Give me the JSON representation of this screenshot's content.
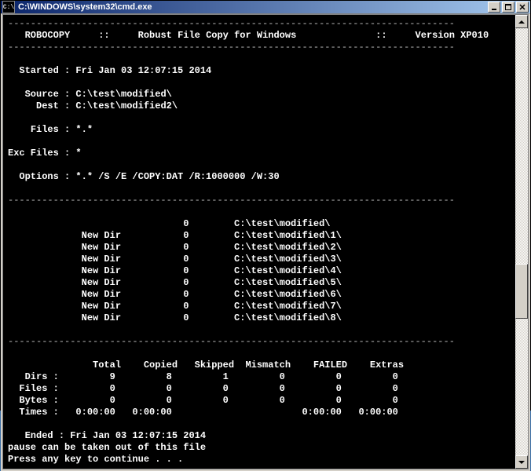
{
  "titlebar": {
    "icon_label": "C:\\",
    "title": "C:\\WINDOWS\\system32\\cmd.exe"
  },
  "hr": "-------------------------------------------------------------------------------",
  "header": {
    "name": "ROBOCOPY",
    "sep": "::",
    "desc": "Robust File Copy for Windows",
    "version": "Version XP010"
  },
  "info": {
    "started_label": "Started",
    "started_value": "Fri Jan 03 12:07:15 2014",
    "source_label": "Source",
    "source_value": "C:\\test\\modified\\",
    "dest_label": "Dest",
    "dest_value": "C:\\test\\modified2\\",
    "files_label": "Files",
    "files_value": "*.*",
    "excfiles_label": "Exc Files",
    "excfiles_value": "*",
    "options_label": "Options",
    "options_value": "*.* /S /E /COPY:DAT /R:1000000 /W:30"
  },
  "dirlist": {
    "newdir": "New Dir",
    "rows": [
      {
        "tag": "",
        "count": "0",
        "path": "C:\\test\\modified\\"
      },
      {
        "tag": "New Dir",
        "count": "0",
        "path": "C:\\test\\modified\\1\\"
      },
      {
        "tag": "New Dir",
        "count": "0",
        "path": "C:\\test\\modified\\2\\"
      },
      {
        "tag": "New Dir",
        "count": "0",
        "path": "C:\\test\\modified\\3\\"
      },
      {
        "tag": "New Dir",
        "count": "0",
        "path": "C:\\test\\modified\\4\\"
      },
      {
        "tag": "New Dir",
        "count": "0",
        "path": "C:\\test\\modified\\5\\"
      },
      {
        "tag": "New Dir",
        "count": "0",
        "path": "C:\\test\\modified\\6\\"
      },
      {
        "tag": "New Dir",
        "count": "0",
        "path": "C:\\test\\modified\\7\\"
      },
      {
        "tag": "New Dir",
        "count": "0",
        "path": "C:\\test\\modified\\8\\"
      }
    ]
  },
  "summary": {
    "headers": [
      "Total",
      "Copied",
      "Skipped",
      "Mismatch",
      "FAILED",
      "Extras"
    ],
    "rows": [
      {
        "label": "Dirs",
        "vals": [
          "9",
          "8",
          "1",
          "0",
          "0",
          "0"
        ]
      },
      {
        "label": "Files",
        "vals": [
          "0",
          "0",
          "0",
          "0",
          "0",
          "0"
        ]
      },
      {
        "label": "Bytes",
        "vals": [
          "0",
          "0",
          "0",
          "0",
          "0",
          "0"
        ]
      },
      {
        "label": "Times",
        "vals": [
          "0:00:00",
          "0:00:00",
          "",
          "",
          "0:00:00",
          "0:00:00"
        ]
      }
    ]
  },
  "footer": {
    "ended_label": "Ended",
    "ended_value": "Fri Jan 03 12:07:15 2014",
    "pause_line": "pause can be taken out of this file",
    "press_key": "Press any key to continue . . ."
  }
}
